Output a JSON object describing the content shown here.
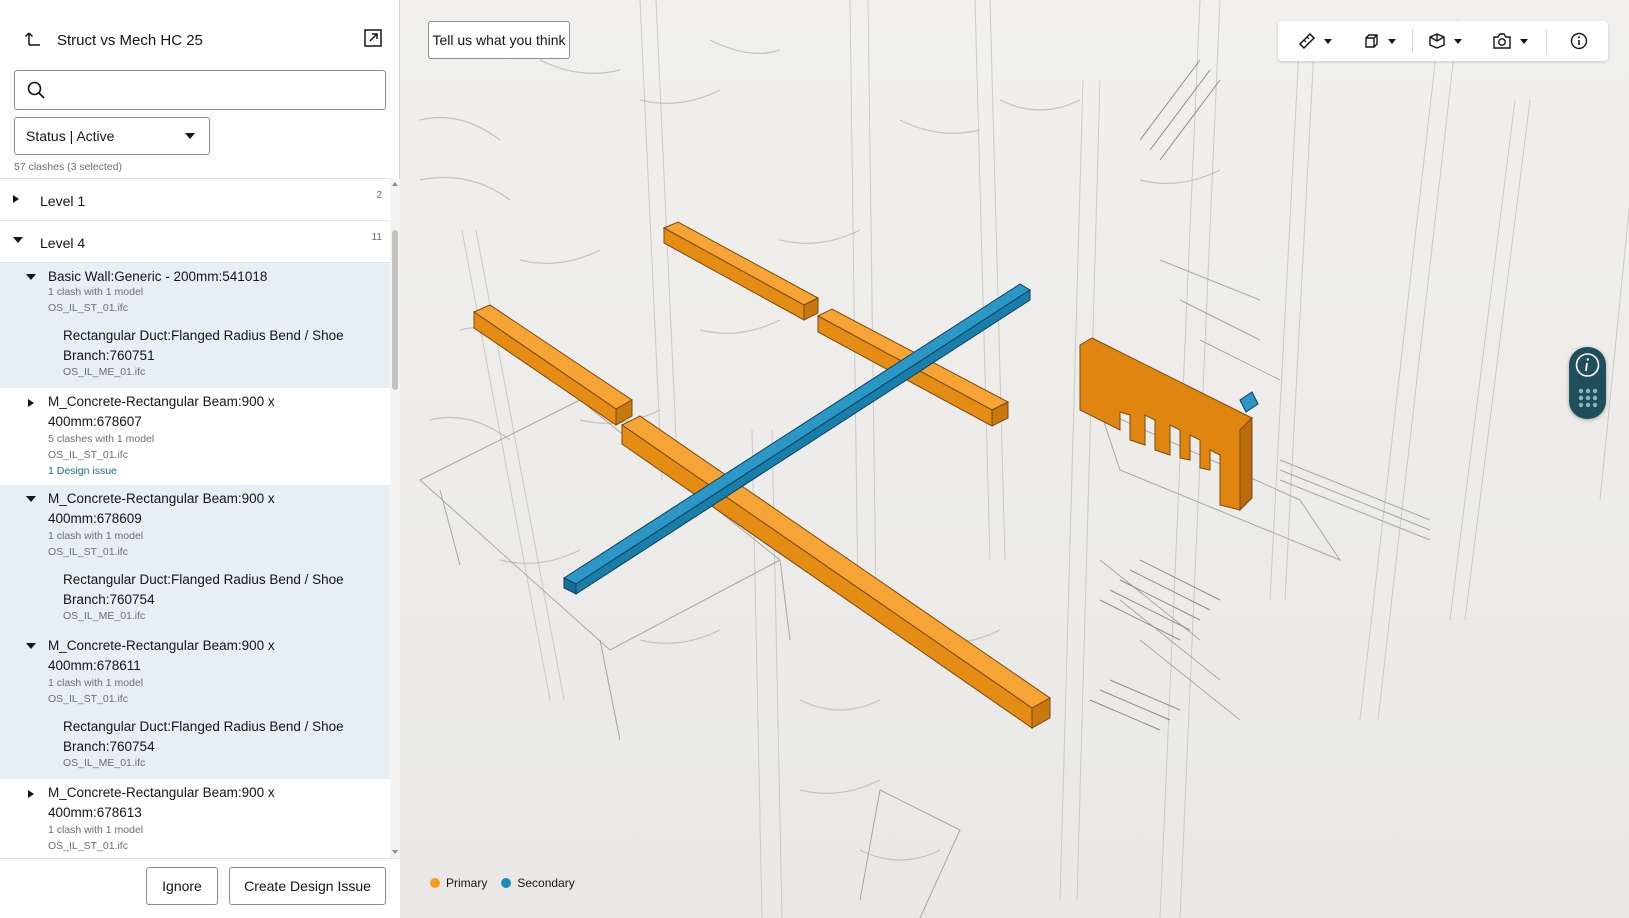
{
  "header": {
    "title": "Struct vs Mech HC 25"
  },
  "search": {
    "placeholder": "",
    "value": ""
  },
  "filter": {
    "status_label": "Status | Active"
  },
  "summary": {
    "count_text": "57 clashes (3 selected)"
  },
  "levels": [
    {
      "label": "Level 1",
      "count": "2"
    },
    {
      "label": "Level 4",
      "count": "11"
    }
  ],
  "items": [
    {
      "name": "Basic Wall:Generic - 200mm:541018",
      "meta1": "1 clash with 1 model",
      "meta2": "OS_IL_ST_01.ifc",
      "child": {
        "name": "Rectangular Duct:Flanged Radius Bend / Shoe Branch:760751",
        "file": "OS_IL_ME_01.ifc"
      }
    },
    {
      "name": "M_Concrete-Rectangular Beam:900 x 400mm:678607",
      "meta1": "5 clashes with 1 model",
      "meta2": "OS_IL_ST_01.ifc",
      "issue": "1 Design issue"
    },
    {
      "name": "M_Concrete-Rectangular Beam:900 x 400mm:678609",
      "meta1": "1 clash with 1 model",
      "meta2": "OS_IL_ST_01.ifc",
      "child": {
        "name": "Rectangular Duct:Flanged Radius Bend / Shoe Branch:760754",
        "file": "OS_IL_ME_01.ifc"
      }
    },
    {
      "name": "M_Concrete-Rectangular Beam:900 x 400mm:678611",
      "meta1": "1 clash with 1 model",
      "meta2": "OS_IL_ST_01.ifc",
      "child": {
        "name": "Rectangular Duct:Flanged Radius Bend / Shoe Branch:760754",
        "file": "OS_IL_ME_01.ifc"
      }
    },
    {
      "name": "M_Concrete-Rectangular Beam:900 x 400mm:678613",
      "meta1": "1 clash with 1 model",
      "meta2": "OS_IL_ST_01.ifc"
    }
  ],
  "footer": {
    "ignore_label": "Ignore",
    "create_label": "Create Design Issue"
  },
  "viewer": {
    "feedback_label": "Tell us what you think"
  },
  "legend": [
    {
      "label": "Primary",
      "color": "#f59c1c"
    },
    {
      "label": "Secondary",
      "color": "#1e8ab8"
    }
  ],
  "colors": {
    "primary": "#f59c1c",
    "secondary": "#1e8ab8",
    "selected_row": "#e5eff5"
  }
}
